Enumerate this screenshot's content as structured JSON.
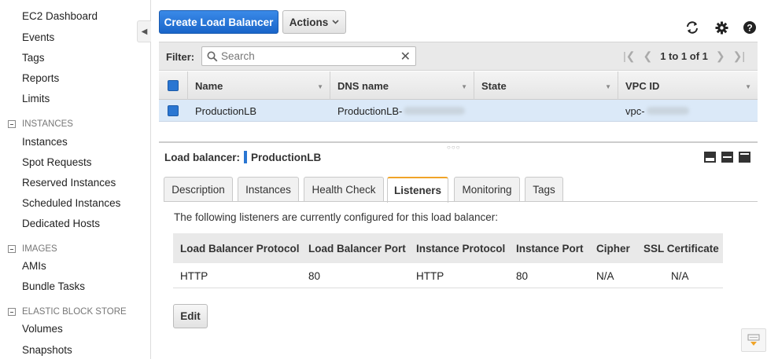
{
  "sidebar": {
    "items": [
      {
        "label": "EC2 Dashboard"
      },
      {
        "label": "Events"
      },
      {
        "label": "Tags"
      },
      {
        "label": "Reports"
      },
      {
        "label": "Limits"
      }
    ],
    "sections": [
      {
        "title": "INSTANCES",
        "items": [
          "Instances",
          "Spot Requests",
          "Reserved Instances",
          "Scheduled Instances",
          "Dedicated Hosts"
        ]
      },
      {
        "title": "IMAGES",
        "items": [
          "AMIs",
          "Bundle Tasks"
        ]
      },
      {
        "title": "ELASTIC BLOCK STORE",
        "items": [
          "Volumes",
          "Snapshots"
        ]
      }
    ]
  },
  "toolbar": {
    "create_label": "Create Load Balancer",
    "actions_label": "Actions",
    "icons": [
      "refresh-icon",
      "gear-icon",
      "help-icon"
    ]
  },
  "filter": {
    "label": "Filter:",
    "placeholder": "Search",
    "pager_text": "1 to 1 of 1"
  },
  "table": {
    "columns": [
      "Name",
      "DNS name",
      "State",
      "VPC ID"
    ],
    "rows": [
      {
        "name": "ProductionLB",
        "dns": "ProductionLB-",
        "state": "",
        "vpc": "vpc-"
      }
    ]
  },
  "detail": {
    "label": "Load balancer:",
    "name": "ProductionLB",
    "tabs": [
      "Description",
      "Instances",
      "Health Check",
      "Listeners",
      "Monitoring",
      "Tags"
    ],
    "active_tab": "Listeners",
    "description": "The following listeners are currently configured for this load balancer:",
    "listeners": {
      "columns": [
        "Load Balancer Protocol",
        "Load Balancer Port",
        "Instance Protocol",
        "Instance Port",
        "Cipher",
        "SSL Certificate"
      ],
      "rows": [
        [
          "HTTP",
          "80",
          "HTTP",
          "80",
          "N/A",
          "N/A"
        ]
      ]
    },
    "edit_label": "Edit"
  },
  "colors": {
    "primary": "#1e6fd9",
    "selected_row": "#dbe9f8",
    "active_tab_accent": "#f0a428"
  }
}
